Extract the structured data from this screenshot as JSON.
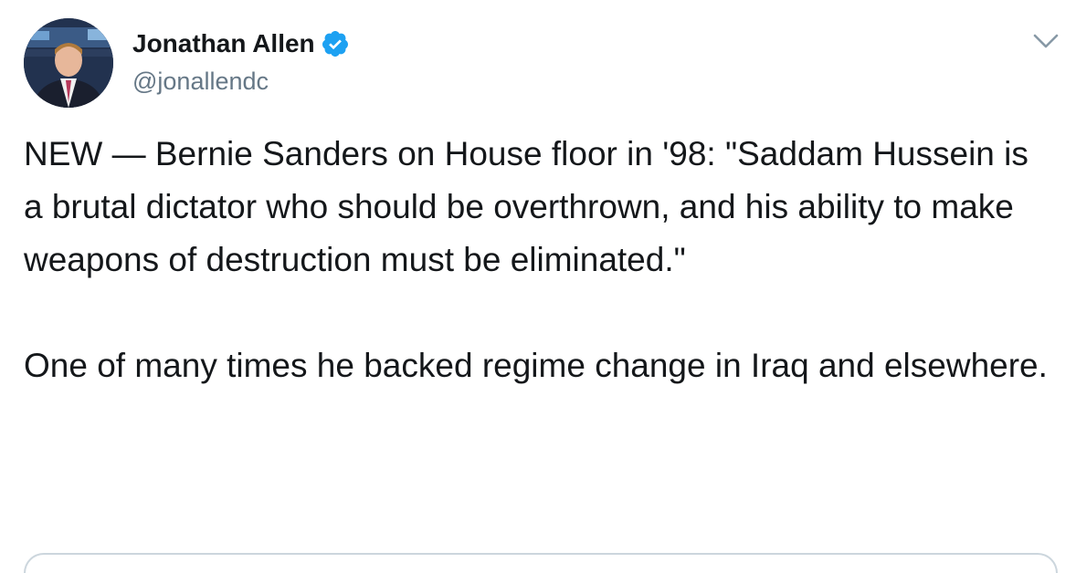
{
  "author": {
    "name": "Jonathan Allen",
    "handle": "@jonallendc",
    "verified": true,
    "avatar_icon": "user-avatar-photo"
  },
  "tweet": {
    "paragraphs": [
      "NEW — Bernie Sanders on House floor in '98: \"Saddam Hussein is a brutal dictator who should be overthrown, and his ability to make weapons of destruction must be eliminated.\"",
      "One of many times he backed regime change in Iraq and elsewhere."
    ]
  },
  "icons": {
    "verified": "verified-badge-icon",
    "menu": "chevron-down-icon"
  },
  "colors": {
    "text": "#14171a",
    "secondary": "#657786",
    "verified_blue": "#1da1f2",
    "border": "#ccd6dd"
  }
}
